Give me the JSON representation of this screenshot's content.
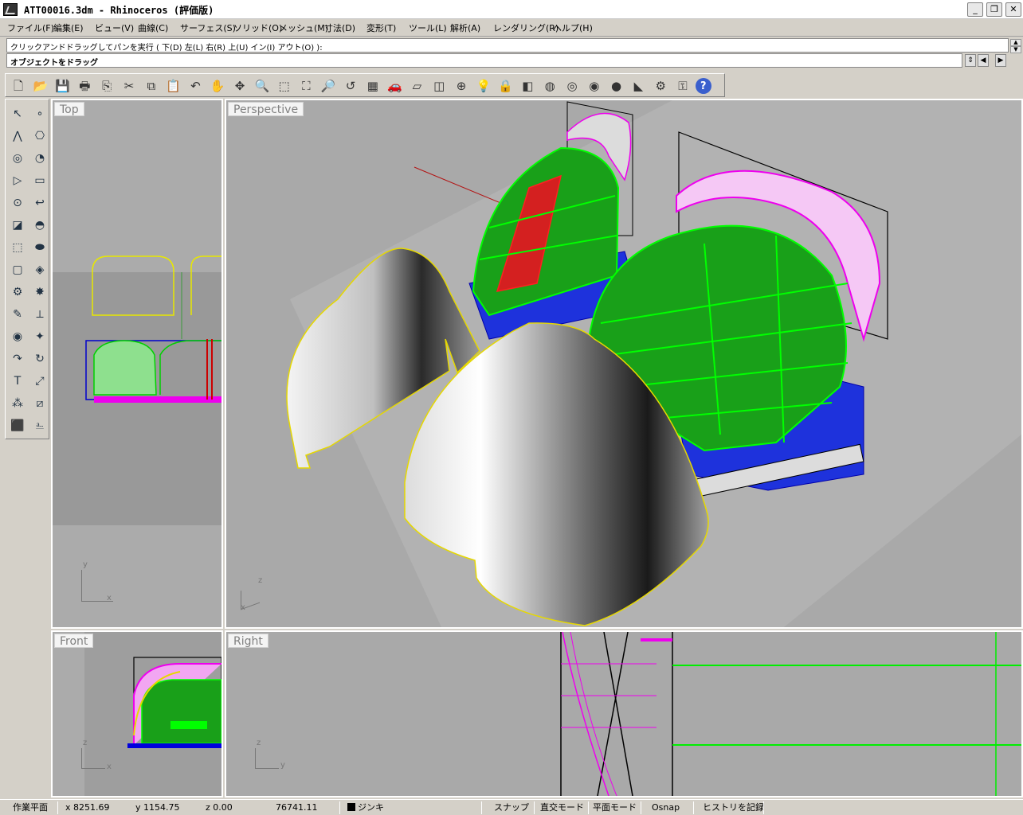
{
  "window": {
    "title": "ATT00016.3dm - Rhinoceros (評価版)",
    "minimize": "_",
    "restore": "❐",
    "close": "✕"
  },
  "menu": [
    "ファイル(F)",
    "編集(E)",
    "ビュー(V)",
    "曲線(C)",
    "サーフェス(S)",
    "ソリッド(O)",
    "メッシュ(M)",
    "寸法(D)",
    "変形(T)",
    "ツール(L)",
    "解析(A)",
    "レンダリング(R)",
    "ヘルプ(H)"
  ],
  "command": {
    "history": "クリックアンドドラッグしてパンを実行 ( 下(D) 左(L) 右(R) 上(U) イン(I) アウト(O) ):",
    "prompt": "オブジェクトをドラッグ"
  },
  "toolbar": {
    "icons": [
      "new-icon",
      "open-icon",
      "save-icon",
      "print-icon",
      "import-icon",
      "cut-icon",
      "copy-icon",
      "paste-icon",
      "undo-icon",
      "pan-hand-icon",
      "rotate-view-icon",
      "zoom-icon",
      "zoom-window-icon",
      "zoom-extents-icon",
      "zoom-selected-icon",
      "undo-view-icon",
      "four-viewports-icon",
      "car-icon",
      "grid-plane-icon",
      "cplane-icon",
      "snap-icon",
      "light-icon",
      "lock-icon",
      "layer-icon",
      "color-wheel-icon",
      "wireframe-icon",
      "shaded-icon",
      "render-icon",
      "flag-icon",
      "gear-icon",
      "options-icon",
      "help-icon"
    ],
    "glyphs": [
      "🗋",
      "📂",
      "💾",
      "🖶",
      "⎘",
      "✂",
      "⧉",
      "📋",
      "↶",
      "✋",
      "✥",
      "🔍",
      "⬚",
      "⛶",
      "🔎",
      "↺",
      "▦",
      "🚗",
      "▱",
      "◫",
      "⊕",
      "💡",
      "🔒",
      "◧",
      "◍",
      "◎",
      "◉",
      "●",
      "◣",
      "⚙",
      "⚿",
      "?"
    ]
  },
  "palette": {
    "glyphs": [
      "↖",
      "∘",
      "⋀",
      "⎔",
      "◎",
      "◔",
      "▷",
      "▭",
      "⊙",
      "↩",
      "◪",
      "◓",
      "⬚",
      "⬬",
      "▢",
      "◈",
      "⚙",
      "✸",
      "✎",
      "⟂",
      "◉",
      "✦",
      "↷",
      "↻",
      "T",
      "⤢",
      "⁂",
      "⧄",
      "⬛",
      "⎁"
    ],
    "icons": [
      "select-arrow-icon",
      "point-icon",
      "polyline-icon",
      "curve-icon",
      "circle-icon",
      "ellipse-icon",
      "polygon-icon",
      "rectangle-icon",
      "circle-tool-icon",
      "fillet-icon",
      "surface-icon",
      "revolve-icon",
      "box-icon",
      "sphere-icon",
      "cylinder-icon",
      "plane-icon",
      "gear-tool-icon",
      "explode-icon",
      "edit-points-icon",
      "dimension-icon",
      "boolean-icon",
      "cluster-icon",
      "arc-icon",
      "rotate-icon",
      "text-icon",
      "scale-icon",
      "array-icon",
      "transform-icon",
      "solid-box-icon",
      "ruler-icon"
    ]
  },
  "viewports": {
    "top": "Top",
    "perspective": "Perspective",
    "front": "Front",
    "right": "Right"
  },
  "axes": {
    "top": {
      "v": "y",
      "h": "x"
    },
    "persp": {
      "v": "z",
      "h": "x"
    },
    "front": {
      "v": "z",
      "h": "x"
    },
    "right": {
      "v": "z",
      "h": "y"
    }
  },
  "statusbar": {
    "cplane": "作業平面",
    "x": "x 8251.69",
    "y": "y 1154.75",
    "z": "z 0.00",
    "distance": "76741.11",
    "layer": "ジンキ",
    "snap": "スナップ",
    "ortho": "直交モード",
    "planar": "平面モード",
    "osnap": "Osnap",
    "history": "ヒストリを記録"
  },
  "colors": {
    "viewport_bg": "#a9a9a9",
    "green": "#00ff00",
    "magenta": "#ff00ff",
    "blue": "#0000ff",
    "yellow": "#ffff00",
    "red": "#ff0000"
  }
}
